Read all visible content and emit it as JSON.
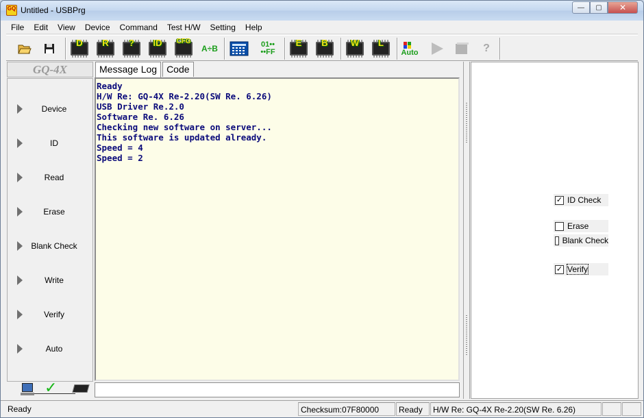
{
  "window": {
    "title": "Untitled - USBPrg",
    "icon_text": "GQ",
    "controls": {
      "minimize": "—",
      "maximize": "▢",
      "close": "✕"
    }
  },
  "menu": [
    "File",
    "Edit",
    "View",
    "Device",
    "Command",
    "Test H/W",
    "Setting",
    "Help"
  ],
  "toolbar": {
    "chip_letters": {
      "device": "D",
      "read": "R",
      "blank": "?",
      "id": "ID",
      "cfg": "CFG",
      "erase": "E",
      "blank2": "B",
      "write": "W",
      "lock": "L"
    },
    "compare": "A÷B",
    "hex_top": "01••",
    "hex_bottom": "••FF",
    "auto": "Auto",
    "help": "?"
  },
  "left_panel": {
    "header": "GQ-4X",
    "operations": [
      "Device",
      "ID",
      "Read",
      "Erase",
      "Blank Check",
      "Write",
      "Verify",
      "Auto"
    ]
  },
  "tabs": [
    {
      "label": "Message Log",
      "active": true
    },
    {
      "label": "Code",
      "active": false
    }
  ],
  "log": [
    "Ready",
    "H/W Re: GQ-4X Re-2.20(SW Re. 6.26)",
    "USB Driver Re.2.0",
    "Software Re. 6.26",
    "Checking new software on server...",
    "This software is updated already.",
    "Speed = 4",
    "Speed = 2"
  ],
  "options": [
    {
      "label": "ID Check",
      "checked": true,
      "mark": "✓"
    },
    {
      "label": "Erase",
      "checked": false,
      "mark": ""
    },
    {
      "label": "Blank Check",
      "checked": false,
      "mark": ""
    },
    {
      "label": "Verify",
      "checked": true,
      "mark": "✓"
    }
  ],
  "statusbar": {
    "left": "Ready",
    "checksum": "Checksum:07F80000",
    "state": "Ready",
    "hw": "H/W Re: GQ-4X Re-2.20(SW Re. 6.26)"
  }
}
